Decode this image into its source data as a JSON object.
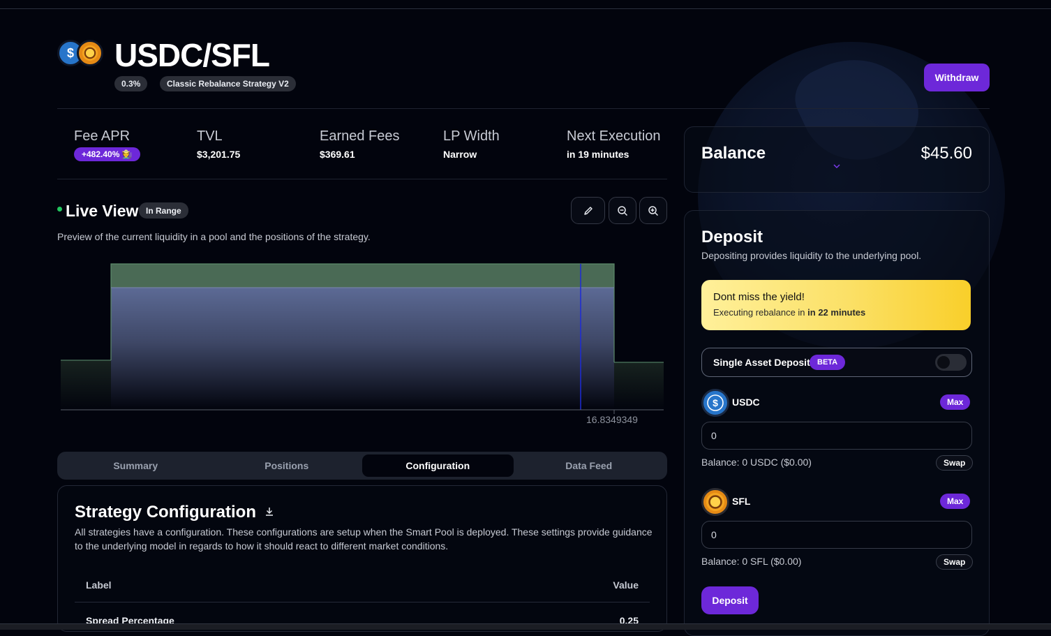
{
  "header": {
    "title": "USDC/SFL",
    "fee_tier": "0.3%",
    "strategy": "Classic Rebalance Strategy V2",
    "withdraw_label": "Withdraw",
    "usdc_symbol": "$"
  },
  "stats": {
    "fee_apr": {
      "label": "Fee APR",
      "value": "+482.40% 🧑‍🌾"
    },
    "tvl": {
      "label": "TVL",
      "value": "$3,201.75"
    },
    "earned_fees": {
      "label": "Earned Fees",
      "value": "$369.61"
    },
    "lp_width": {
      "label": "LP Width",
      "value": "Narrow"
    },
    "next_execution": {
      "label": "Next Execution",
      "value": "in 19 minutes"
    }
  },
  "live_view": {
    "title": "Live View",
    "status": "In Range",
    "description": "Preview of the current liquidity in a pool and the positions of the strategy.",
    "tools": [
      "pencil-icon",
      "zoom-out-icon",
      "zoom-in-icon"
    ]
  },
  "chart_data": {
    "type": "area",
    "x_tick_label": "16.8349349",
    "current_price_marker": "blue-line",
    "colors": {
      "position": "#4a6a55",
      "liquidity": "#5a6690",
      "marker": "#1d2bd6"
    }
  },
  "tabs": [
    {
      "label": "Summary",
      "active": false
    },
    {
      "label": "Positions",
      "active": false
    },
    {
      "label": "Configuration",
      "active": true
    },
    {
      "label": "Data Feed",
      "active": false
    }
  ],
  "config": {
    "title": "Strategy Configuration",
    "description": "All strategies have a configuration. These configurations are setup when the Smart Pool is deployed. These settings provide guidance to the underlying model in regards to how it should react to different market conditions.",
    "col_label": "Label",
    "col_value": "Value",
    "rows": [
      {
        "label": "Spread Percentage",
        "value": "0.25"
      }
    ]
  },
  "balance": {
    "label": "Balance",
    "value": "$45.60"
  },
  "deposit": {
    "title": "Deposit",
    "description": "Depositing provides liquidity to the underlying pool.",
    "banner_title": "Dont miss the yield!",
    "banner_text": "Executing rebalance in",
    "banner_time": "in 22 minutes",
    "single_asset_label": "Single Asset Deposit",
    "beta_label": "BETA",
    "single_asset_enabled": false,
    "tokens": [
      {
        "name": "USDC",
        "max_label": "Max",
        "value": "0",
        "balance": "Balance: 0 USDC ($0.00)",
        "swap_label": "Swap"
      },
      {
        "name": "SFL",
        "max_label": "Max",
        "value": "0",
        "balance": "Balance: 0 SFL ($0.00)",
        "swap_label": "Swap"
      }
    ],
    "button_label": "Deposit"
  },
  "colors": {
    "accent": "#6d28d9",
    "background": "#02040d",
    "in_range": "#22c55e",
    "banner": "#fbe066"
  }
}
